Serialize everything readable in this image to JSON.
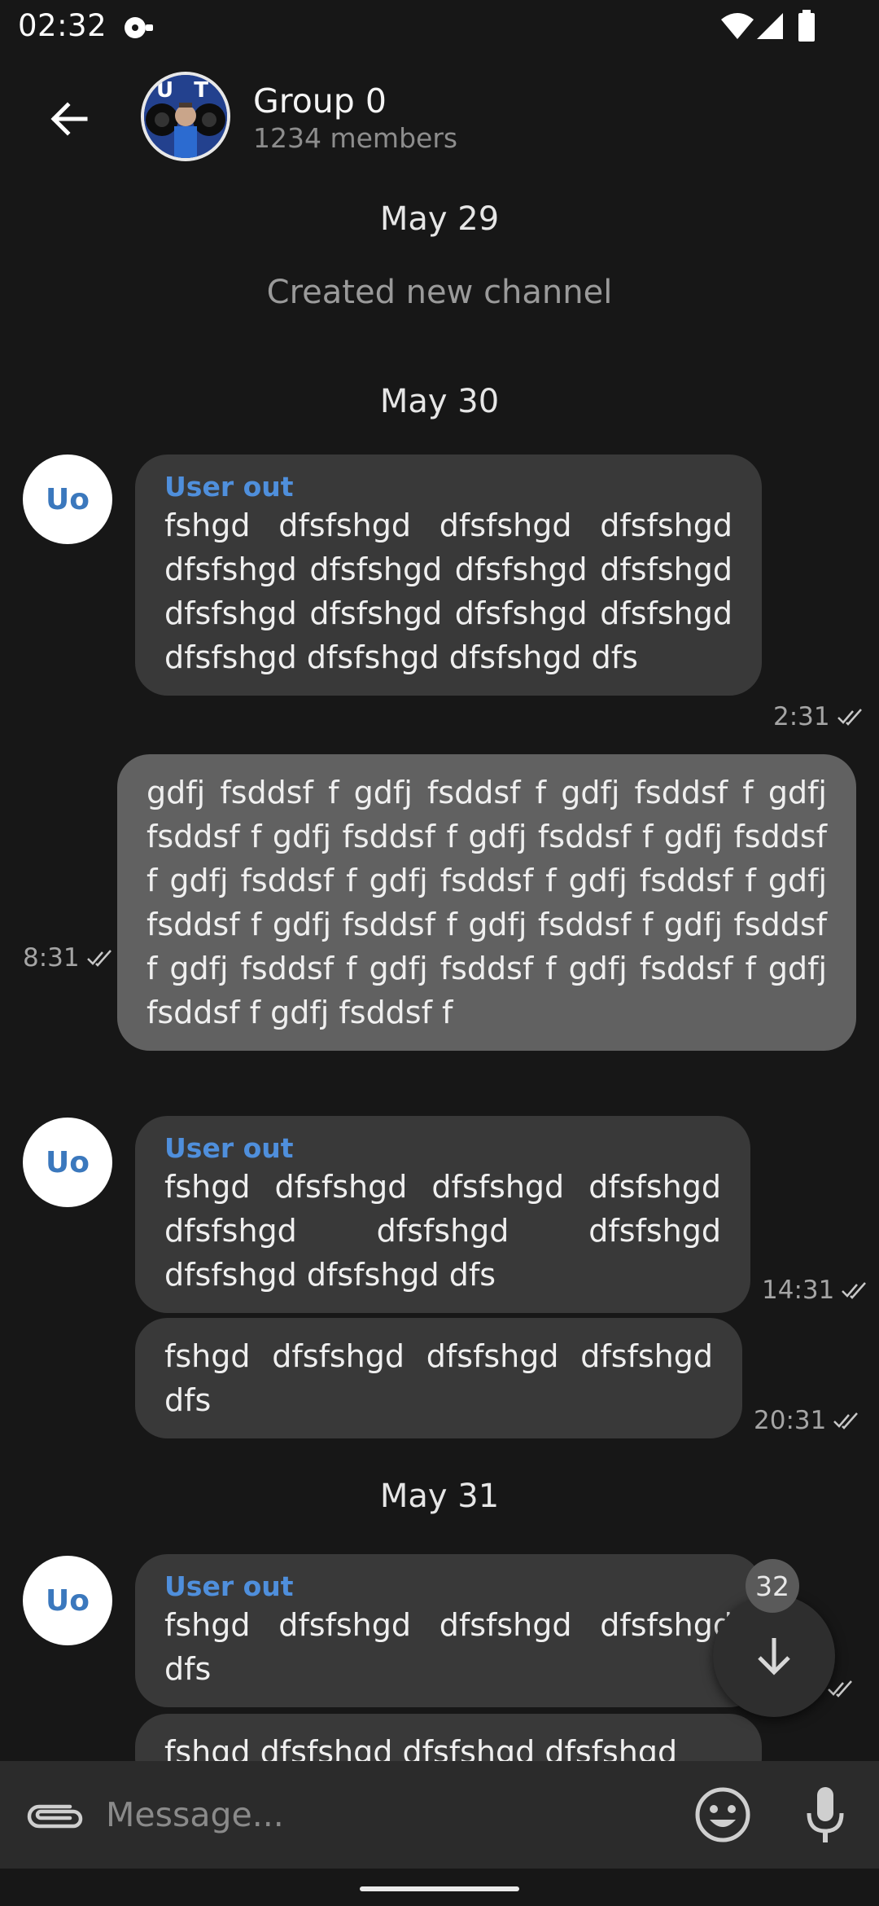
{
  "status_bar": {
    "time": "02:32"
  },
  "header": {
    "title": "Group 0",
    "subtitle": "1234 members",
    "avatar_text": "U T"
  },
  "chat": {
    "dates": [
      "May 29",
      "May 30",
      "May 31"
    ],
    "service_message": "Created new channel",
    "avatar_initials": "Uo",
    "messages": [
      {
        "sender": "User out",
        "text": "fshgd dfsfshgd dfsfshgd dfsfshgd dfsfshgd dfsfshgd dfsfshgd dfsfshgd dfsfshgd dfsfshgd dfsfshgd dfsfshgd dfsfshgd dfsfshgd dfsfshgd dfs",
        "time": "2:31"
      },
      {
        "sender": "",
        "text": "gdfj fsddsf f gdfj fsddsf f gdfj fsddsf f gdfj fsddsf f gdfj fsddsf f gdfj fsddsf f gdfj fsddsf f gdfj fsddsf f gdfj fsddsf f gdfj fsddsf f gdfj fsddsf f gdfj fsddsf f gdfj fsddsf f gdfj fsddsf f gdfj fsddsf f gdfj fsddsf f gdfj fsddsf f gdfj fsddsf f gdfj fsddsf f",
        "time": "8:31"
      },
      {
        "sender": "User out",
        "text": "fshgd dfsfshgd dfsfshgd dfsfshgd dfsfshgd dfsfshgd dfsfshgd dfsfshgd dfsfshgd dfs",
        "time": "14:31"
      },
      {
        "sender": "",
        "text": "fshgd dfsfshgd dfsfshgd dfsfshgd dfs",
        "time": "20:31"
      },
      {
        "sender": "User out",
        "text": "fshgd dfsfshgd dfsfshgd dfsfshgd dfs",
        "time": ""
      },
      {
        "sender": "",
        "text": "fshgd dfsfshgd dfsfshgd dfsfshgd",
        "time": ""
      }
    ]
  },
  "scroll_down": {
    "unread_count": "32"
  },
  "composer": {
    "placeholder": "Message..."
  },
  "colors": {
    "background": "#171717",
    "incoming_bubble": "#393939",
    "outgoing_bubble": "#616161",
    "accent": "#4f8fdc"
  }
}
